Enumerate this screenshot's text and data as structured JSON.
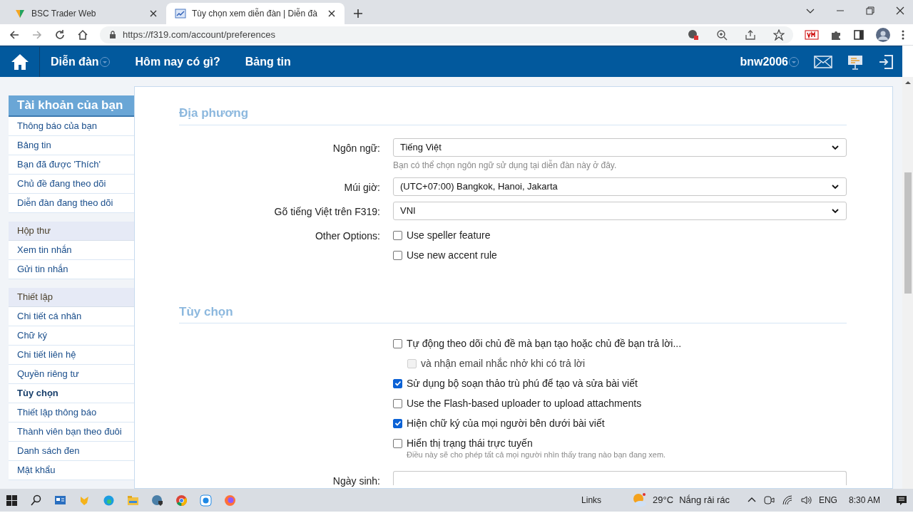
{
  "browser": {
    "tabs": [
      {
        "title": "BSC Trader Web",
        "selected": false
      },
      {
        "title": "Tùy chọn xem diễn đàn | Diễn đà",
        "selected": true
      }
    ],
    "url": "https://f319.com/account/preferences"
  },
  "nav": {
    "items": [
      {
        "label": "Diễn đàn",
        "dropdown": true
      },
      {
        "label": "Hôm nay có gì?",
        "dropdown": false
      },
      {
        "label": "Bảng tin",
        "dropdown": false
      }
    ],
    "user": {
      "name": "bnw2006",
      "dropdown": true
    }
  },
  "sidebar": {
    "sections": [
      {
        "title": "Tài khoản của bạn",
        "kind": "heading",
        "items": [
          {
            "label": "Thông báo của bạn",
            "selected": false
          },
          {
            "label": "Bảng tin",
            "selected": false
          },
          {
            "label": "Bạn đã được 'Thích'",
            "selected": false
          },
          {
            "label": "Chủ đề đang theo dõi",
            "selected": false
          },
          {
            "label": "Diễn đàn đang theo dõi",
            "selected": false
          }
        ]
      },
      {
        "title": "Hộp thư",
        "kind": "group",
        "items": [
          {
            "label": "Xem tin nhắn",
            "selected": false
          },
          {
            "label": "Gửi tin nhắn",
            "selected": false
          }
        ]
      },
      {
        "title": "Thiết lập",
        "kind": "group",
        "items": [
          {
            "label": "Chi tiết cá nhân",
            "selected": false
          },
          {
            "label": "Chữ ký",
            "selected": false
          },
          {
            "label": "Chi tiết liên hệ",
            "selected": false
          },
          {
            "label": "Quyền riêng tư",
            "selected": false
          },
          {
            "label": "Tùy chọn",
            "selected": true
          },
          {
            "label": "Thiết lập thông báo",
            "selected": false
          },
          {
            "label": "Thành viên bạn theo đuôi",
            "selected": false
          },
          {
            "label": "Danh sách đen",
            "selected": false
          },
          {
            "label": "Mật khẩu",
            "selected": false
          }
        ]
      }
    ]
  },
  "form": {
    "sections": [
      {
        "title": "Địa phương",
        "rows": [
          {
            "kind": "select",
            "label": "Ngôn ngữ:",
            "value": "Tiếng Việt",
            "hint": "Bạn có thể chọn ngôn ngữ sử dụng tại diễn đàn này ở đây."
          },
          {
            "kind": "select",
            "label": "Múi giờ:",
            "value": "(UTC+07:00) Bangkok, Hanoi, Jakarta"
          },
          {
            "kind": "select",
            "label": "Gõ tiếng Việt trên F319:",
            "value": "VNI"
          },
          {
            "kind": "checkboxes",
            "label": "Other Options:",
            "options": [
              {
                "label": "Use speller feature",
                "checked": false,
                "disabled": false
              },
              {
                "label": "Use new accent rule",
                "checked": false,
                "disabled": false
              }
            ]
          }
        ]
      },
      {
        "title": "Tùy chọn",
        "rows": [
          {
            "kind": "checkboxes",
            "options": [
              {
                "label": "Tự động theo dõi chủ đề mà bạn tạo hoặc chủ đề bạn trả lời...",
                "checked": false,
                "disabled": false,
                "children": [
                  {
                    "label": "và nhận email nhắc nhở khi có trả lời",
                    "checked": false,
                    "disabled": true
                  }
                ]
              },
              {
                "label": "Sử dụng bộ soạn thảo trù phú để tạo và sửa bài viết",
                "checked": true,
                "disabled": false
              },
              {
                "label": "Use the Flash-based uploader to upload attachments",
                "checked": false,
                "disabled": false
              },
              {
                "label": "Hiện chữ ký của mọi người bên dưới bài viết",
                "checked": true,
                "disabled": false
              },
              {
                "label": "Hiển thị trạng thái trực tuyến",
                "checked": false,
                "disabled": false,
                "hint": "Điều này sẽ cho phép tất cả mọi người nhìn thấy trang nào bạn đang xem."
              }
            ]
          },
          {
            "kind": "input",
            "label": "Ngày sinh:"
          }
        ]
      }
    ]
  },
  "taskbar": {
    "links": "Links",
    "temperature": "29°C",
    "weather": "Nắng rải rác",
    "language": "ENG",
    "time": "8:30 AM"
  }
}
